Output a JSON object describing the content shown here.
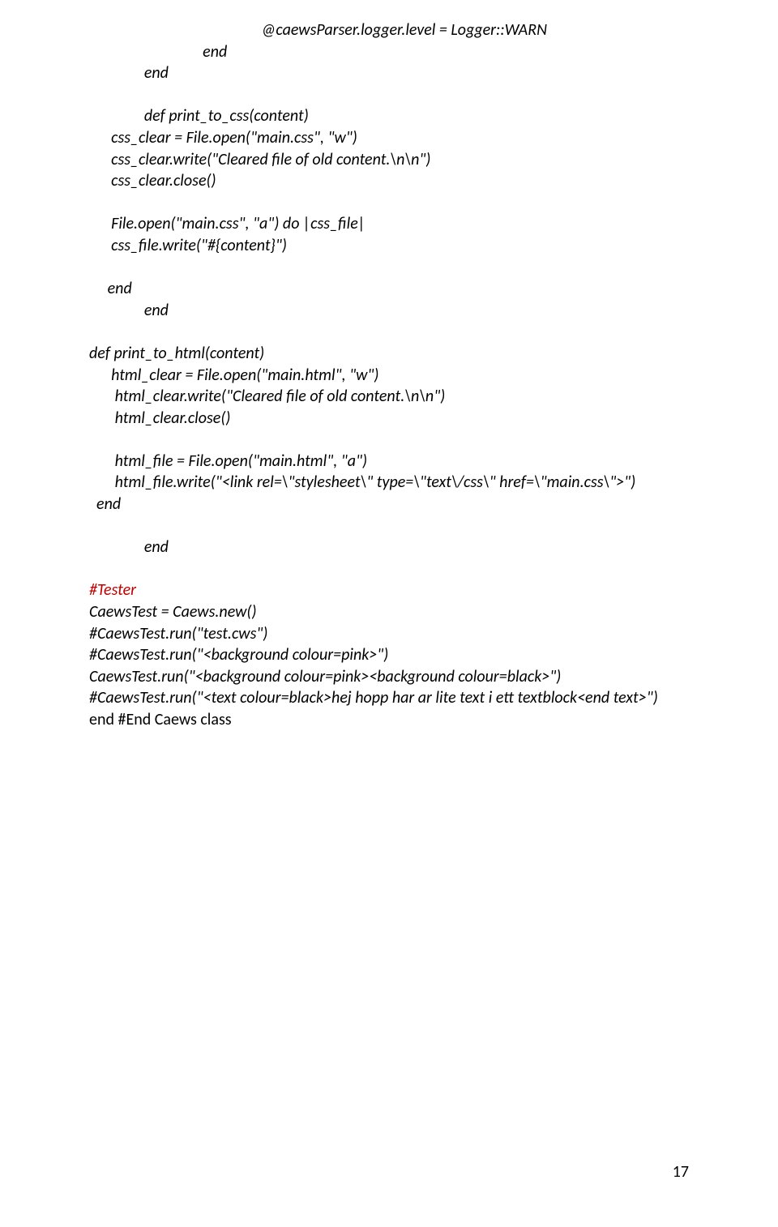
{
  "lines": [
    {
      "cls": "line",
      "text": "                                               @caewsParser.logger.level = Logger::WARN"
    },
    {
      "cls": "line",
      "text": "                               end"
    },
    {
      "cls": "line",
      "text": "               end"
    },
    {
      "cls": "line",
      "text": ""
    },
    {
      "cls": "line",
      "text": "               def print_to_css(content)"
    },
    {
      "cls": "line",
      "text": "      css_clear = File.open(\"main.css\", \"w\")"
    },
    {
      "cls": "line",
      "text": "      css_clear.write(\"Cleared file of old content.\\n\\n\")"
    },
    {
      "cls": "line",
      "text": "      css_clear.close()"
    },
    {
      "cls": "line",
      "text": ""
    },
    {
      "cls": "line",
      "text": "      File.open(\"main.css\", \"a\") do |css_file|"
    },
    {
      "cls": "line",
      "text": "      css_file.write(\"#{content}\")"
    },
    {
      "cls": "line",
      "text": ""
    },
    {
      "cls": "line",
      "text": "     end"
    },
    {
      "cls": "line",
      "text": "               end"
    },
    {
      "cls": "line",
      "text": ""
    },
    {
      "cls": "line",
      "text": "def print_to_html(content)"
    },
    {
      "cls": "line",
      "text": "      html_clear = File.open(\"main.html\", \"w\")"
    },
    {
      "cls": "line",
      "text": "       html_clear.write(\"Cleared file of old content.\\n\\n\")"
    },
    {
      "cls": "line",
      "text": "       html_clear.close()"
    },
    {
      "cls": "line",
      "text": ""
    },
    {
      "cls": "line",
      "text": "       html_file = File.open(\"main.html\", \"a\")"
    },
    {
      "cls": "line",
      "text": "       html_file.write(\"<link rel=\\\"stylesheet\\\" type=\\\"text\\/css\\\" href=\\\"main.css\\\">\")"
    },
    {
      "cls": "line",
      "text": "  end"
    },
    {
      "cls": "line",
      "text": ""
    },
    {
      "cls": "line",
      "text": "               end"
    },
    {
      "cls": "line",
      "text": ""
    },
    {
      "cls": "line red",
      "text": "#Tester"
    },
    {
      "cls": "line",
      "text": "CaewsTest = Caews.new()"
    },
    {
      "cls": "line",
      "text": "#CaewsTest.run(\"test.cws\")"
    },
    {
      "cls": "line",
      "text": "#CaewsTest.run(\"<background colour=pink>\")"
    },
    {
      "cls": "line",
      "text": "CaewsTest.run(\"<background colour=pink><background colour=black>\")"
    },
    {
      "cls": "line",
      "text": "#CaewsTest.run(\"<text colour=black>hej hopp har ar lite text i ett textblock<end text>\")"
    },
    {
      "cls": "line plain",
      "text": "end #End Caews class"
    }
  ],
  "page_number": "17"
}
